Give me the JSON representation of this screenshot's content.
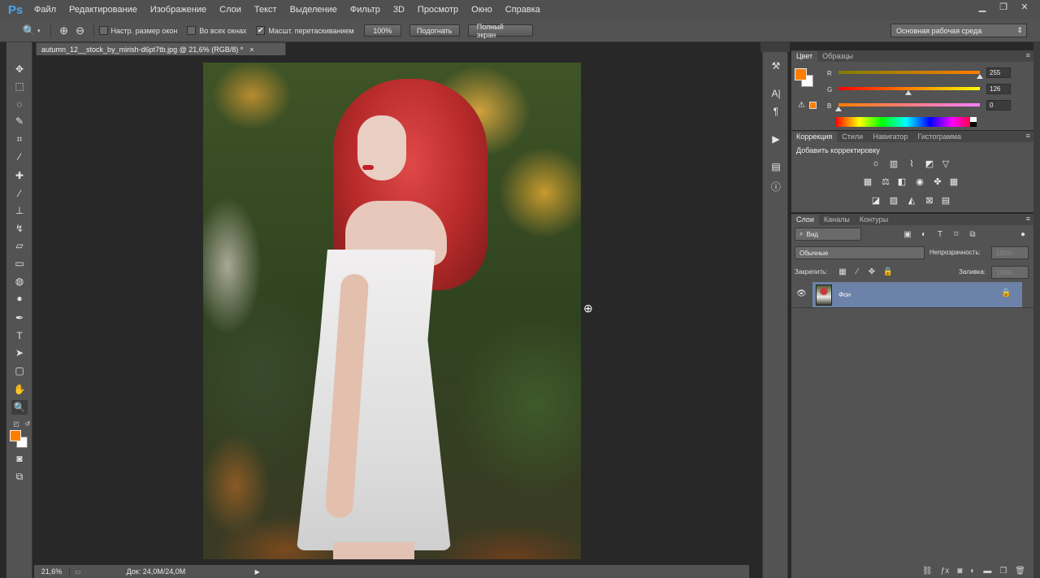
{
  "app": {
    "logo": "Ps"
  },
  "menu": [
    "Файл",
    "Редактирование",
    "Изображение",
    "Слои",
    "Текст",
    "Выделение",
    "Фильтр",
    "3D",
    "Просмотр",
    "Окно",
    "Справка"
  ],
  "window_controls": {
    "minimize": "▁",
    "restore": "❐",
    "close": "✕"
  },
  "options_bar": {
    "tool_icon": "zoom-icon",
    "resize_windows": "Настр. размер окон",
    "all_windows": "Во всех окнах",
    "scrubby_zoom": "Масшт. перетаскиванием",
    "btn_100": "100%",
    "btn_fit": "Подогнать",
    "btn_fullscreen": "Полный экран",
    "workspace": "Основная рабочая среда"
  },
  "document": {
    "tab_title": "autumn_12__stock_by_mirish-d6pt7tb.jpg @ 21,6% (RGB/8) *",
    "close": "×"
  },
  "statusbar": {
    "zoom": "21,6%",
    "doc_size": "Док: 24,0M/24,0M",
    "arrow": "▶"
  },
  "color_panel": {
    "tabs": [
      "Цвет",
      "Образцы"
    ],
    "fg_color": "#ff7e00",
    "bg_color": "#ffffff",
    "r_label": "R",
    "r_value": "255",
    "g_label": "G",
    "g_value": "126",
    "b_label": "B",
    "b_value": "0",
    "warning": "⚠"
  },
  "adjustments_panel": {
    "tabs": [
      "Коррекция",
      "Стили",
      "Навигатор",
      "Гистограмма"
    ],
    "title": "Добавить корректировку"
  },
  "layers_panel": {
    "tabs": [
      "Слои",
      "Каналы",
      "Контуры"
    ],
    "filter_kind": "Вид",
    "blend_mode": "Обычные",
    "opacity_label": "Непрозрачность:",
    "opacity_value": "100%",
    "lock_label": "Закрепить:",
    "fill_label": "Заливка:",
    "fill_value": "100%",
    "layer_name": "Фон"
  },
  "colors": {
    "ui_dark": "#282828",
    "panel": "#535353",
    "selection": "#6c82a8",
    "accent_orange": "#ff7e00",
    "logo_blue": "#4fa3e6"
  }
}
